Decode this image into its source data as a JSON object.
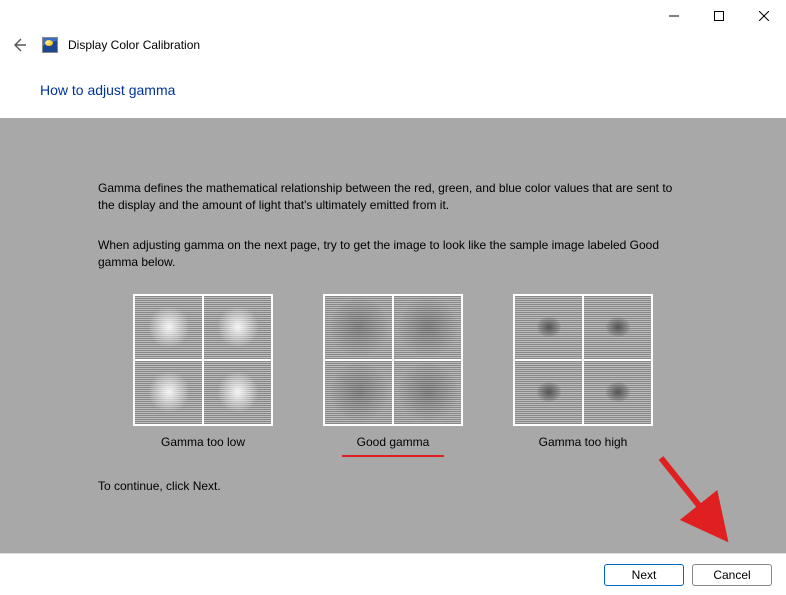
{
  "window": {
    "app_title": "Display Color Calibration",
    "page_heading": "How to adjust gamma"
  },
  "body": {
    "para1": "Gamma defines the mathematical relationship between the red, green, and blue color values that are sent to the display and the amount of light that's ultimately emitted from it.",
    "para2": "When adjusting gamma on the next page, try to get the image to look like the sample image labeled Good gamma below.",
    "continue": "To continue, click Next."
  },
  "samples": {
    "low": "Gamma too low",
    "good": "Good gamma",
    "high": "Gamma too high"
  },
  "footer": {
    "next": "Next",
    "cancel": "Cancel"
  }
}
